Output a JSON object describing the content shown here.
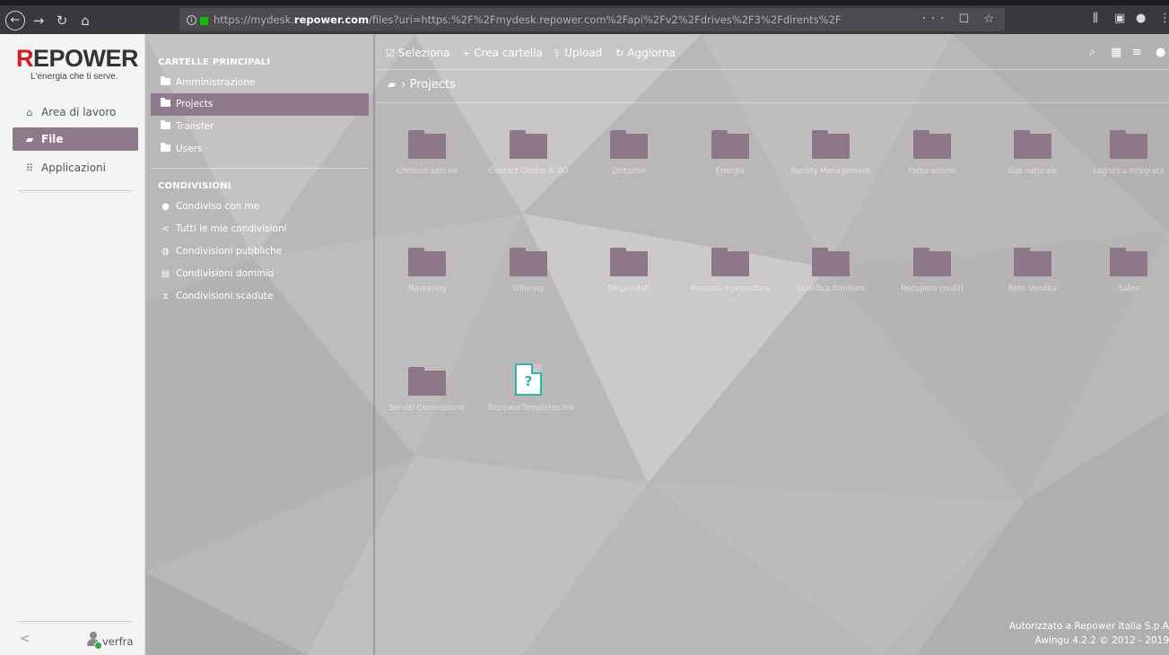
{
  "browser": {
    "url_host_prefix": "https://mydesk.",
    "url_host": "repower.com",
    "url_rest": "/files?uri=https:%2F%2Fmydesk.repower.com%2Fapi%2Fv2%2Fdrives%2F3%2Fdirents%2F",
    "page_actions": "··· ☐ ☆"
  },
  "app": {
    "logo_r": "R",
    "logo_rest": "EPOWER",
    "tagline": "L'energia che ti serve.",
    "nav": [
      {
        "label": "Area di lavoro",
        "icon": "home-icon"
      },
      {
        "label": "File",
        "icon": "folder-open-icon"
      },
      {
        "label": "Applicazioni",
        "icon": "grid-icon"
      }
    ],
    "collapse": "<",
    "username": "verfra"
  },
  "folders": {
    "main_header": "CARTELLE PRINCIPALI",
    "main": [
      "Amministrazione",
      "Projects",
      "Transfer",
      "Users"
    ],
    "shares_header": "CONDIVISIONI",
    "shares": [
      {
        "label": "Condiviso con me",
        "icon": "user-icon"
      },
      {
        "label": "Tutti le mie condivisioni",
        "icon": "share-icon"
      },
      {
        "label": "Condivisioni pubbliche",
        "icon": "globe-icon"
      },
      {
        "label": "Condivisioni dominio",
        "icon": "building-icon"
      },
      {
        "label": "Condivisioni scadute",
        "icon": "hourglass-icon"
      }
    ]
  },
  "toolbar": {
    "select": "Seleziona",
    "new_folder": "Crea cartella",
    "upload": "Upload",
    "refresh": "Aggiorna"
  },
  "breadcrumb": {
    "current": "Projects"
  },
  "items": [
    {
      "name": "Comunicazio ne",
      "type": "folder"
    },
    {
      "name": "Contact Center & BO",
      "type": "folder"
    },
    {
      "name": "Distorsio",
      "type": "folder"
    },
    {
      "name": "Energia",
      "type": "folder"
    },
    {
      "name": "Facility Management",
      "type": "folder"
    },
    {
      "name": "Fatturazione",
      "type": "folder"
    },
    {
      "name": "Gas naturale",
      "type": "folder"
    },
    {
      "name": "Logistica integrata",
      "type": "folder"
    },
    {
      "name": "Marketing",
      "type": "folder"
    },
    {
      "name": "Offering",
      "type": "folder"
    },
    {
      "name": "Origini dati",
      "type": "folder"
    },
    {
      "name": "Processi e procedure ...",
      "type": "folder"
    },
    {
      "name": "Qualifica fornitore",
      "type": "folder"
    },
    {
      "name": "Recupero crediti",
      "type": "folder"
    },
    {
      "name": "Rete Vendita",
      "type": "folder"
    },
    {
      "name": "Sales",
      "type": "folder"
    },
    {
      "name": "Servizi Connessione",
      "type": "folder"
    },
    {
      "name": "RepowerTemplates.lnk",
      "type": "file",
      "glyph": "?"
    }
  ],
  "footer": {
    "line1": "Autorizzato a Repower Italia S.p.A",
    "line2": "Awingu 4.2.2 © 2012 - 2019"
  },
  "colors": {
    "accent": "#8e7a8c",
    "file_accent": "#2bb7a7",
    "brand_red": "#d71a21"
  }
}
